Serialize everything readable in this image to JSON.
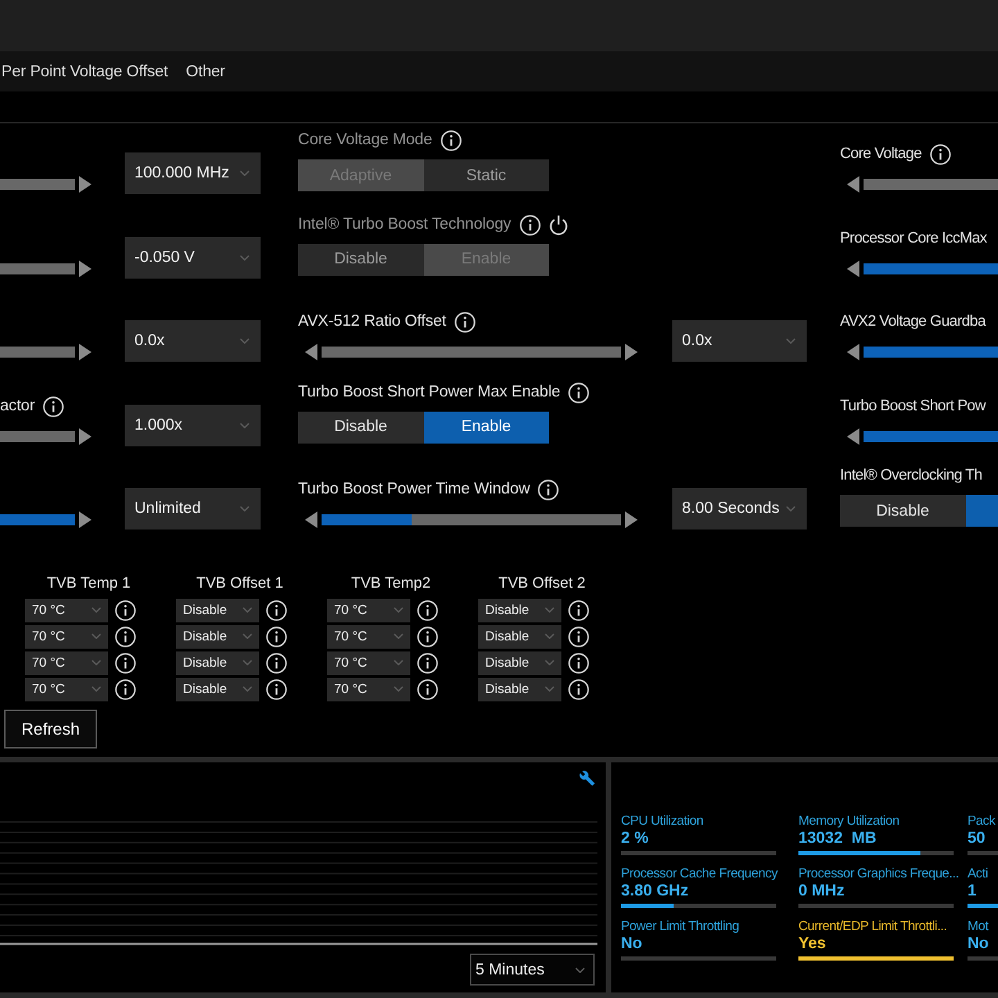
{
  "tabs": [
    {
      "label": "Per Point Voltage Offset",
      "selected": false
    },
    {
      "label": "Other",
      "selected": false
    }
  ],
  "left_column": [
    {
      "kind": "slider",
      "value": "100.000 MHz"
    },
    {
      "kind": "slider",
      "value": "-0.050 V"
    },
    {
      "kind": "slider",
      "value": "0.0x"
    },
    {
      "kind": "slider",
      "label": "actor",
      "info_button": true,
      "value": "1.000x"
    },
    {
      "kind": "slider",
      "level": 1,
      "value": "Unlimited"
    }
  ],
  "middle_column": [
    {
      "kind": "toggle",
      "label": "Core Voltage Mode",
      "info_button": true,
      "disabled": true,
      "options": [
        {
          "label": "Adaptive",
          "selected": true
        },
        {
          "label": "Static",
          "selected": false
        }
      ]
    },
    {
      "kind": "toggle",
      "label": "Intel® Turbo Boost Technology",
      "info_button": true,
      "power_button": true,
      "disabled": true,
      "options": [
        {
          "label": "Disable",
          "selected": false
        },
        {
          "label": "Enable",
          "selected": true
        }
      ]
    },
    {
      "kind": "slider",
      "label": "AVX-512 Ratio Offset",
      "info_button": true,
      "value": "0.0x"
    },
    {
      "kind": "toggle",
      "label": "Turbo Boost Short Power Max Enable",
      "info_button": true,
      "disabled": false,
      "options": [
        {
          "label": "Disable",
          "selected": false
        },
        {
          "label": "Enable",
          "selected": true
        }
      ]
    },
    {
      "kind": "slider",
      "label": "Turbo Boost Power Time Window",
      "info_button": true,
      "level": 0.3,
      "value": "8.00 Seconds"
    }
  ],
  "right_column": [
    {
      "kind": "slider",
      "label": "Core Voltage",
      "info_button": true
    },
    {
      "kind": "slider",
      "label": "Processor Core IccMax",
      "level": 1
    },
    {
      "kind": "slider",
      "label": "AVX2 Voltage Guardba",
      "level": 1
    },
    {
      "kind": "slider",
      "label": "Turbo Boost Short Pow",
      "level": 1
    },
    {
      "kind": "toggle",
      "label": "Intel® Overclocking Th",
      "disabled": false,
      "options": [
        {
          "label": "Disable",
          "selected": false
        },
        {
          "selected": true
        }
      ]
    }
  ],
  "tvb_table": {
    "columns": [
      "TVB Temp 1",
      "TVB Offset 1",
      "TVB Temp2",
      "TVB Offset 2"
    ],
    "rows": [
      [
        "70 °C",
        "Disable",
        "70 °C",
        "Disable"
      ],
      [
        "70 °C",
        "Disable",
        "70 °C",
        "Disable"
      ],
      [
        "70 °C",
        "Disable",
        "70 °C",
        "Disable"
      ],
      [
        "70 °C",
        "Disable",
        "70 °C",
        "Disable"
      ]
    ]
  },
  "refresh_button": "Refresh",
  "chart_panel": {
    "time_range": "5 Minutes"
  },
  "metrics": [
    {
      "label": "CPU Utilization",
      "value": "2 %",
      "warning": false
    },
    {
      "label": "Memory Utilization",
      "value": "13032  MB",
      "level": 0.79,
      "warning": false
    },
    {
      "label": "Pack",
      "value": "50",
      "warning": false
    },
    {
      "label": "Processor Cache Frequency",
      "value": "3.80 GHz",
      "level": 0.34,
      "warning": false
    },
    {
      "label": "Processor Graphics Freque...",
      "value": "0 MHz",
      "warning": false
    },
    {
      "label": "Acti",
      "value": "1",
      "level": 1,
      "warning": false
    },
    {
      "label": "Power Limit Throttling",
      "value": "No",
      "warning": false
    },
    {
      "label": "Current/EDP Limit Throttli...",
      "value": "Yes",
      "level": 1,
      "warning": true
    },
    {
      "label": "Mot",
      "value": "No",
      "warning": false
    }
  ]
}
